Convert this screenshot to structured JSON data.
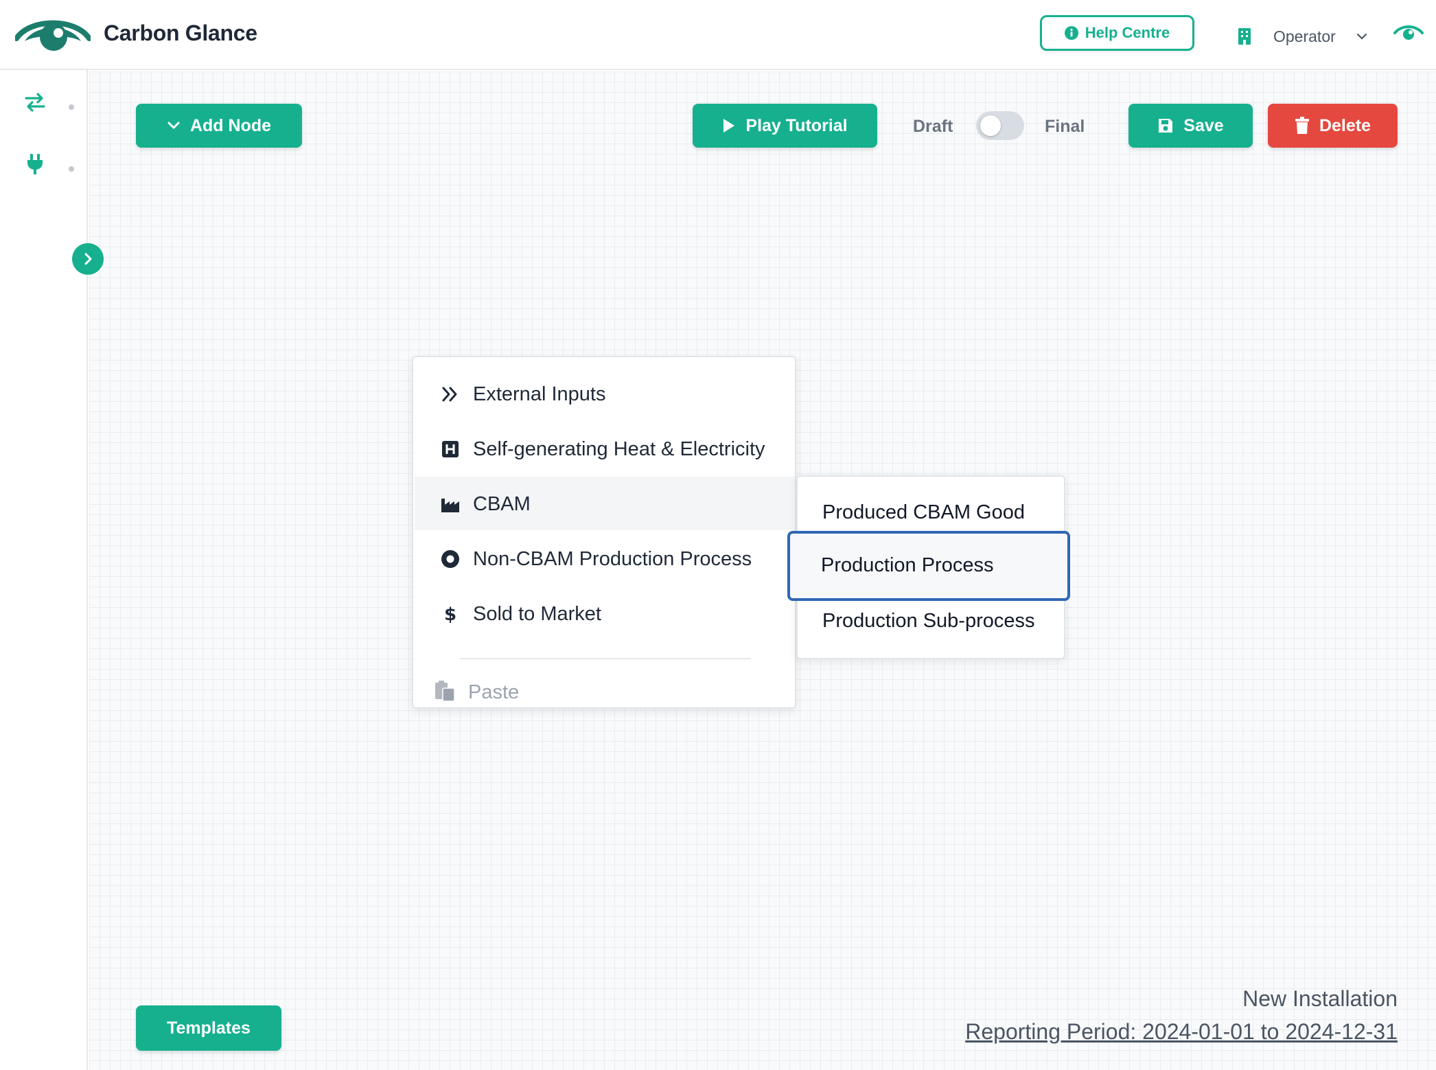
{
  "app": {
    "title": "Carbon Glance",
    "brand_color": "#16b08f",
    "danger_color": "#e5483f",
    "focus_color": "#2f67b5"
  },
  "header": {
    "help_label": "Help Centre",
    "role_label": "Operator",
    "icons": [
      "logo-eye-icon",
      "info-icon",
      "building-icon",
      "chevron-down-icon",
      "eye-icon"
    ]
  },
  "rail": {
    "icons": [
      "arrows-exchange-icon",
      "plug-icon",
      "chevron-right-icon"
    ]
  },
  "toolbar": {
    "add_node_label": "Add Node",
    "play_tutorial_label": "Play Tutorial",
    "draft_label": "Draft",
    "final_label": "Final",
    "draft_final_toggle_on": false,
    "save_label": "Save",
    "delete_label": "Delete"
  },
  "context_menu": {
    "items": [
      {
        "label": "External Inputs",
        "icon": "double-chevron-right-icon"
      },
      {
        "label": "Self-generating Heat & Electricity",
        "icon": "h-square-icon"
      },
      {
        "label": "CBAM",
        "icon": "industry-icon",
        "active": true
      },
      {
        "label": "Non-CBAM Production Process",
        "icon": "dot-circle-icon"
      },
      {
        "label": "Sold to Market",
        "icon": "dollar-icon"
      }
    ],
    "paste": {
      "label": "Paste",
      "icon": "clipboard-icon",
      "disabled": true
    }
  },
  "cbam_submenu": {
    "items": [
      {
        "label": "Produced CBAM Good"
      },
      {
        "label": "Production Process",
        "focused": true
      },
      {
        "label": "Production Sub-process"
      }
    ]
  },
  "footer": {
    "templates_label": "Templates",
    "installation_name": "New Installation",
    "reporting_period": "Reporting Period: 2024-01-01 to 2024-12-31"
  }
}
